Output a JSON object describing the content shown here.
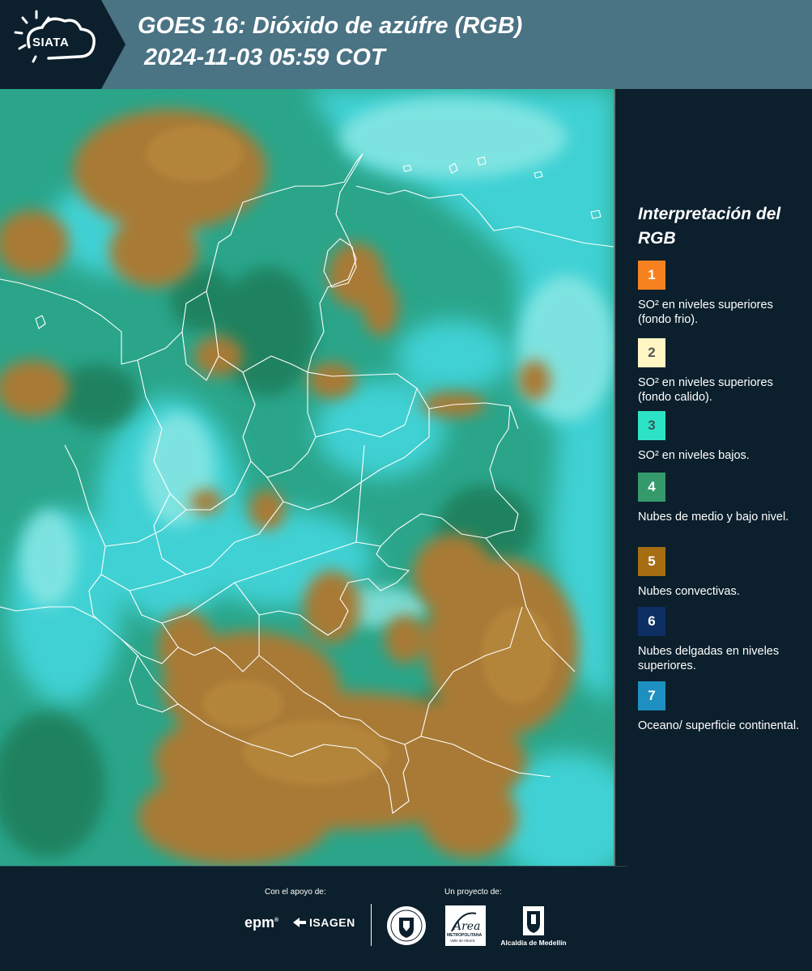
{
  "header": {
    "logo_text": "SIATA",
    "title_line1": "GOES 16: Dióxido de azúfre (RGB)",
    "title_line2": "2024-11-03 05:59 COT"
  },
  "legend": {
    "title": "Interpretación del RGB",
    "items": [
      {
        "number": "1",
        "label": "SO² en niveles superiores (fondo frio).",
        "color": "#f5821f",
        "text_color": "#ffffff"
      },
      {
        "number": "2",
        "label": "SO² en niveles superiores (fondo calido).",
        "color": "#fff6c4",
        "text_color": "#555555"
      },
      {
        "number": "3",
        "label": "SO² en niveles bajos.",
        "color": "#2de3c6",
        "text_color": "#3a5a5a"
      },
      {
        "number": "4",
        "label": "Nubes de medio y bajo nivel.",
        "color": "#349a6b",
        "text_color": "#ffffff"
      },
      {
        "number": "5",
        "label": "Nubes convectivas.",
        "color": "#a66d12",
        "text_color": "#ffffff"
      },
      {
        "number": "6",
        "label": "Nubes delgadas en niveles superiores.",
        "color": "#0d2f63",
        "text_color": "#ffffff"
      },
      {
        "number": "7",
        "label": "Oceano/ superficie continental.",
        "color": "#1e8fc1",
        "text_color": "#ffffff"
      }
    ]
  },
  "footer": {
    "support_caption": "Con el apoyo de:",
    "project_caption": "Un proyecto de:",
    "epm_logo": "epm",
    "epm_reg": "®",
    "isagen_logo": "ISAGEN",
    "amva_logo_text": "Área",
    "amva_subtext": "METROPOLITANA",
    "amva_subtext2": "Valle de Aburrá",
    "alcaldia_logo": "Alcaldía de Medellín"
  },
  "colors": {
    "header_bg": "#4a7384",
    "body_bg": "#0b1f2c",
    "convective": "#a87a35",
    "low_so2": "#3ec8c8",
    "mid_clouds": "#2e9a6e"
  }
}
